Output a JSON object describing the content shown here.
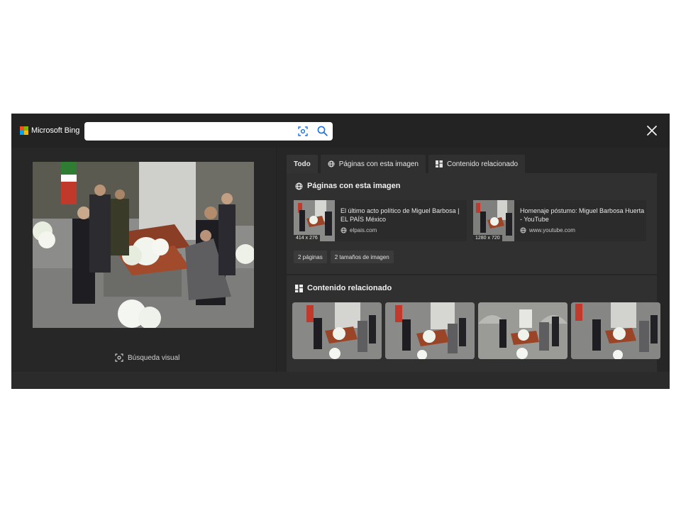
{
  "header": {
    "brand": "Microsoft Bing",
    "search_placeholder": "",
    "search_value": ""
  },
  "left": {
    "visual_search_label": "Búsqueda visual"
  },
  "tabs": [
    {
      "label": "Todo",
      "icon": "none",
      "active": true
    },
    {
      "label": "Páginas con esta imagen",
      "icon": "globe-icon",
      "active": false
    },
    {
      "label": "Contenido relacionado",
      "icon": "grid-icon",
      "active": false
    }
  ],
  "pages_section": {
    "title": "Páginas con esta imagen",
    "cards": [
      {
        "title": "El último acto político de Miguel Barbosa | EL PAÍS México",
        "source": "elpais.com",
        "dimensions": "414 x 276"
      },
      {
        "title": "Homenaje póstumo: Miguel Barbosa Huerta - YouTube",
        "source": "www.youtube.com",
        "dimensions": "1280 x 720"
      }
    ],
    "chips": [
      "2 páginas",
      "2 tamaños de imagen"
    ]
  },
  "related_section": {
    "title": "Contenido relacionado"
  },
  "colors": {
    "background": "#262626",
    "topbar": "#232323",
    "panel": "#303030",
    "accent_icon": "#1a73e8"
  }
}
